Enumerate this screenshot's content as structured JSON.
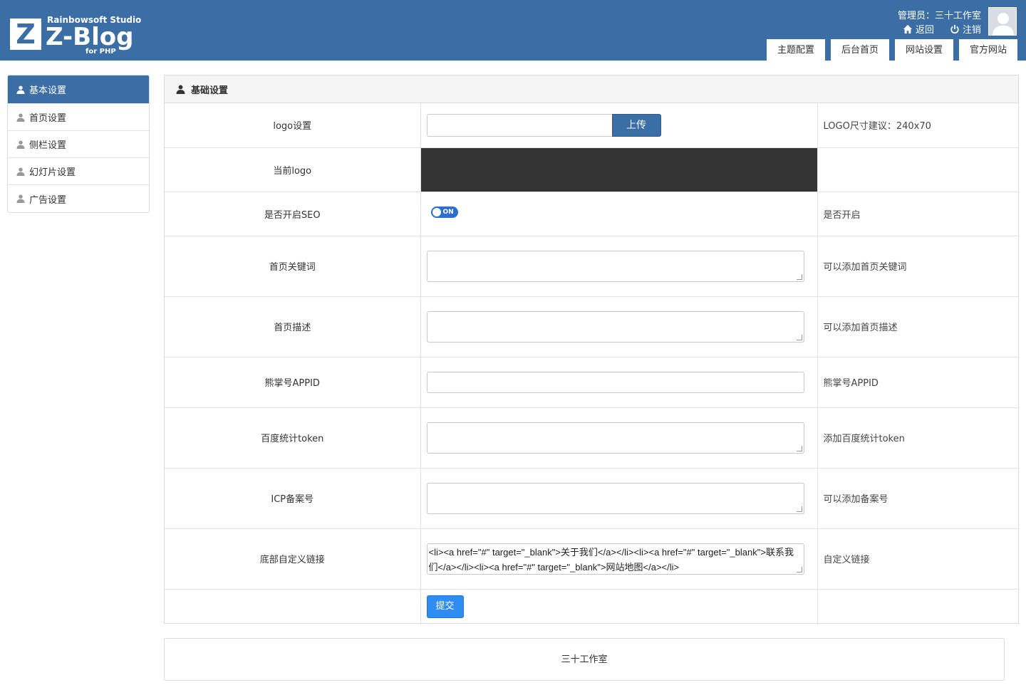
{
  "brand": {
    "letter": "Z",
    "studio": "Rainbowsoft Studio",
    "name": "Z-Blog",
    "sub": "for PHP"
  },
  "user": {
    "line": "管理员：三十工作室",
    "back": "返回",
    "logout": "注销"
  },
  "top_tabs": [
    "主题配置",
    "后台首页",
    "网站设置",
    "官方网站"
  ],
  "sidebar": {
    "items": [
      {
        "label": "基本设置",
        "active": true
      },
      {
        "label": "首页设置",
        "active": false
      },
      {
        "label": "侧栏设置",
        "active": false
      },
      {
        "label": "幻灯片设置",
        "active": false
      },
      {
        "label": "广告设置",
        "active": false
      }
    ]
  },
  "panel": {
    "title": "基础设置",
    "rows": [
      {
        "label": "logo设置",
        "hint": "LOGO尺寸建议：240x70"
      },
      {
        "label": "当前logo",
        "hint": ""
      },
      {
        "label": "是否开启SEO",
        "hint": "是否开启"
      },
      {
        "label": "首页关键词",
        "hint": "可以添加首页关键词"
      },
      {
        "label": "首页描述",
        "hint": "可以添加首页描述"
      },
      {
        "label": "熊掌号APPID",
        "hint": "熊掌号APPID"
      },
      {
        "label": "百度统计token",
        "hint": "添加百度统计token"
      },
      {
        "label": "ICP备案号",
        "hint": "可以添加备案号"
      },
      {
        "label": "底部自定义链接",
        "hint": "自定义链接"
      }
    ],
    "upload_label": "上传",
    "toggle_label": "ON",
    "footer_links_value": "<li><a href=\"#\" target=\"_blank\">关于我们</a></li><li><a href=\"#\" target=\"_blank\">联系我们</a></li><li><a href=\"#\" target=\"_blank\">网站地图</a></li>",
    "submit_label": "提交"
  },
  "footer": {
    "text": "三十工作室"
  },
  "colors": {
    "brand": "#3a6ea5",
    "submit": "#2f8cf0",
    "toggle": "#2a6fc9"
  }
}
